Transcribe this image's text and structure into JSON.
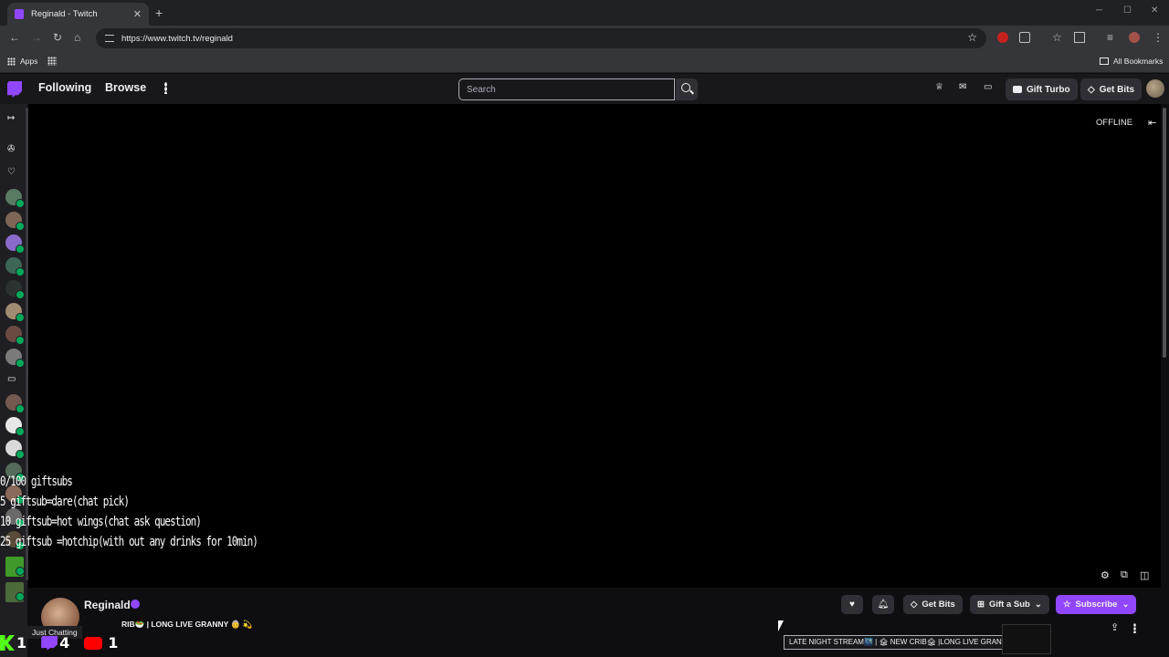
{
  "browser": {
    "tab_title": "Reginald - Twitch",
    "url": "https://www.twitch.tv/reginald",
    "bookmarks": {
      "apps": "Apps",
      "all": "All Bookmarks"
    }
  },
  "nav": {
    "following": "Following",
    "browse": "Browse",
    "search_placeholder": "Search",
    "gift_turbo": "Gift Turbo",
    "get_bits": "Get Bits"
  },
  "player": {
    "status": "OFFLINE",
    "overlay_lines": [
      "0/100 giftsubs",
      "5 giftsub=dare(chat pick)",
      "10 giftsub=hot wings(chat ask question)",
      "25 giftsub =hotchip(with out any drinks for 10min)"
    ]
  },
  "channel": {
    "name": "Reginald",
    "title": "RIB🥗 | LONG LIVE GRANNY 👵 💫",
    "category": "Just Chatting",
    "stats": {
      "kick": "1",
      "twitch": "4",
      "youtube": "1"
    },
    "get_bits": "Get Bits",
    "gift_sub": "Gift a Sub",
    "subscribe": "Subscribe",
    "tooltip": "LATE NIGHT STREAM🌃 | 🏚 NEW CRIB🏚 |LONG LIVE GRANNY 👵"
  },
  "colors": {
    "accent": "#9146ff",
    "live": "#00a85a",
    "background": "#0e0e10"
  }
}
